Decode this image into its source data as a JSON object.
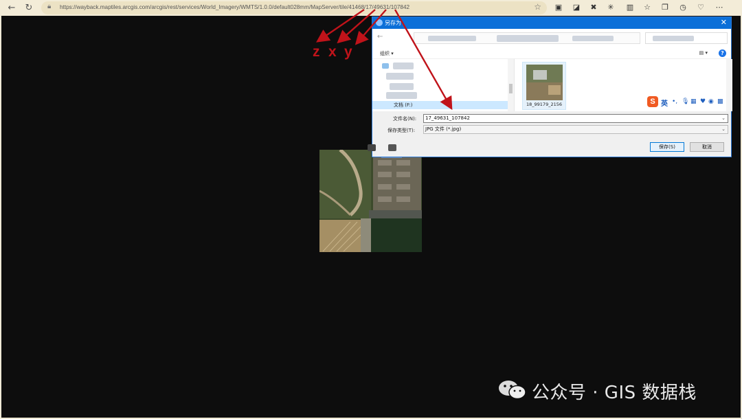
{
  "browser": {
    "url": "https://wayback.maptiles.arcgis.com/arcgis/rest/services/World_Imagery/WMTS/1.0.0/default028mm/MapServer/tile/41468/17/49631/107842",
    "icons": [
      "back-icon",
      "refresh-icon",
      "lock-icon",
      "star-icon",
      "extension-icon",
      "collections-icon",
      "tracking-icon",
      "puzzle-icon",
      "split-icon",
      "favorites-icon",
      "tabs-icon",
      "history-icon",
      "performance-icon",
      "more-icon"
    ]
  },
  "annotation": {
    "labels": [
      "z",
      "x",
      "y"
    ],
    "color": "#c0131a"
  },
  "dialog": {
    "title": "另存为",
    "organize_label": "组织 ▾",
    "selected_folder": "文档 (F:)",
    "file_thumbnail_name": "18_99179_2156",
    "filename_label": "文件名(N):",
    "filename_value": "17_49631_107842",
    "filetype_label": "保存类型(T):",
    "filetype_value": "JPG 文件 (*.jpg)",
    "save_button": "保存(S)",
    "cancel_button": "取消",
    "ime_lang": "英"
  },
  "watermark": {
    "text": "公众号 · GIS 数据栈"
  }
}
